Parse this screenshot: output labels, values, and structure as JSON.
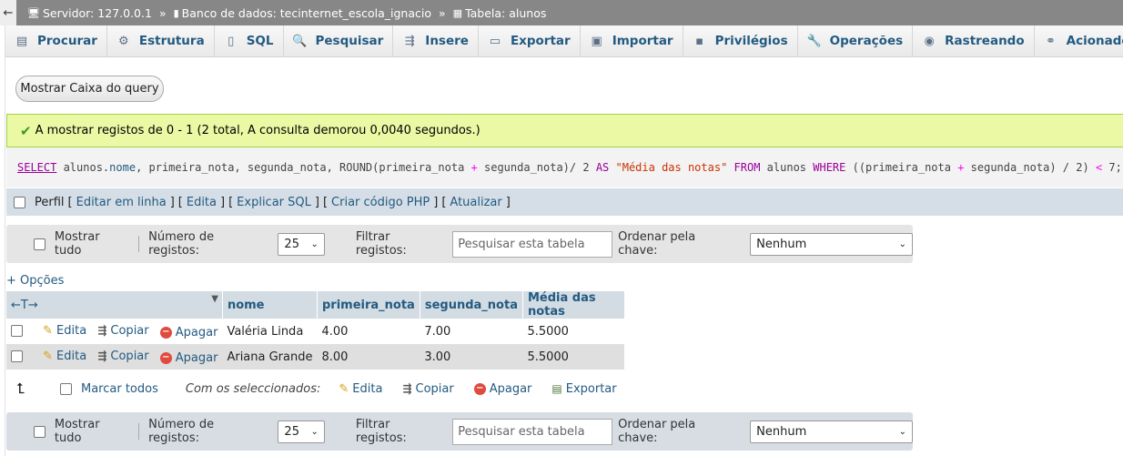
{
  "breadcrumb": {
    "back": "←",
    "server": "Servidor: 127.0.0.1",
    "database": "Banco de dados: tecinternet_escola_ignacio",
    "table": "Tabela: alunos",
    "separator": "»"
  },
  "tabs": [
    {
      "label": "Procurar",
      "icon": "browse-icon"
    },
    {
      "label": "Estrutura",
      "icon": "structure-icon"
    },
    {
      "label": "SQL",
      "icon": "sql-icon"
    },
    {
      "label": "Pesquisar",
      "icon": "search-icon"
    },
    {
      "label": "Insere",
      "icon": "insert-icon"
    },
    {
      "label": "Exportar",
      "icon": "export-icon"
    },
    {
      "label": "Importar",
      "icon": "import-icon"
    },
    {
      "label": "Privilégios",
      "icon": "privileges-icon"
    },
    {
      "label": "Operações",
      "icon": "wrench-icon"
    },
    {
      "label": "Rastreando",
      "icon": "eye-icon"
    },
    {
      "label": "Acionadores",
      "icon": "triggers-icon"
    }
  ],
  "query_button": "Mostrar Caixa do query",
  "success_message": "A mostrar registos de 0 - 1 (2 total, A consulta demorou 0,0040 segundos.)",
  "sql": {
    "kw_select": "SELECT",
    "part1": " alunos.",
    "col_nome": "nome",
    "part2": ", primeira_nota, segunda_nota, ROUND(primeira_nota ",
    "plus1": "+",
    "part3": " segunda_nota)/ 2 ",
    "kw_as": "AS",
    "alias": " \"Média das notas\" ",
    "kw_from": "FROM",
    "part4": " alunos ",
    "kw_where": "WHERE",
    "part5": " ((primeira_nota ",
    "plus2": "+",
    "part6": " segunda_nota) / 2) ",
    "lt": "<",
    "part7": " 7;"
  },
  "sql_ops": {
    "profile": "Perfil",
    "edit_inline": "Editar em linha",
    "edit": "Edita",
    "explain": "Explicar SQL",
    "php": "Criar código PHP",
    "refresh": "Atualizar",
    "lbr": "[",
    "rbr": "]"
  },
  "navbar": {
    "show_all": "Mostrar tudo",
    "num_rows_label": "Número de registos:",
    "num_rows_value": "25",
    "filter_label": "Filtrar registos:",
    "filter_placeholder": "Pesquisar esta tabela",
    "sort_label": "Ordenar pela chave:",
    "sort_value": "Nenhum"
  },
  "options_link": "+ Opções",
  "table": {
    "arrows": "←T→",
    "columns": [
      "nome",
      "primeira_nota",
      "segunda_nota",
      "Média das notas"
    ],
    "row_actions": {
      "edit": "Edita",
      "copy": "Copiar",
      "delete": "Apagar"
    },
    "rows": [
      {
        "nome": "Valéria Linda",
        "primeira_nota": "4.00",
        "segunda_nota": "7.00",
        "media": "5.5000"
      },
      {
        "nome": "Ariana Grande",
        "primeira_nota": "8.00",
        "segunda_nota": "3.00",
        "media": "5.5000"
      }
    ]
  },
  "bulk": {
    "check_all": "Marcar todos",
    "with_selected": "Com os seleccionados:",
    "edit": "Edita",
    "copy": "Copiar",
    "delete": "Apagar",
    "export": "Exportar"
  }
}
